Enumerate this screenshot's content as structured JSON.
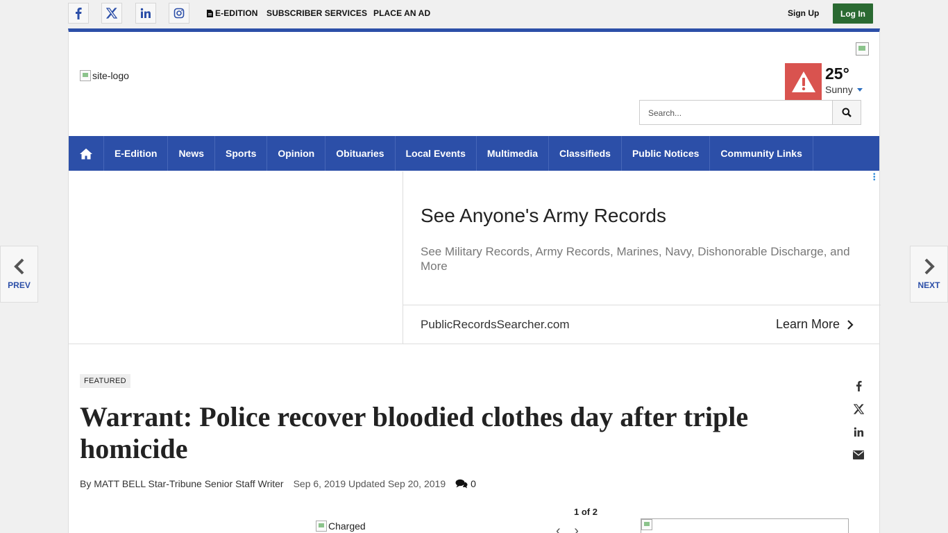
{
  "topbar": {
    "social": [
      {
        "name": "facebook-icon"
      },
      {
        "name": "x-twitter-icon"
      },
      {
        "name": "linkedin-icon"
      },
      {
        "name": "instagram-icon"
      }
    ],
    "eedition_label": "E-EDITION",
    "subscriber_label": "SUBSCRIBER SERVICES",
    "place_ad_label": "PLACE AN AD",
    "signup_label": "Sign Up",
    "login_label": "Log In"
  },
  "header": {
    "logo_alt": "site-logo",
    "weather": {
      "temp": "25°",
      "condition": "Sunny",
      "alert_icon": "warning-icon"
    },
    "search": {
      "placeholder": "Search..."
    }
  },
  "nav": {
    "items": [
      "E-Edition",
      "News",
      "Sports",
      "Opinion",
      "Obituaries",
      "Local Events",
      "Multimedia",
      "Classifieds",
      "Public Notices",
      "Community Links"
    ]
  },
  "ad": {
    "title": "See Anyone's Army Records",
    "description": "See Military Records, Army Records, Marines, Navy, Dishonorable Discharge, and More",
    "domain": "PublicRecordsSearcher.com",
    "cta": "Learn More"
  },
  "article": {
    "badge": "FEATURED",
    "headline": "Warrant: Police recover bloodied clothes day after triple homicide",
    "byline": "By MATT BELL Star-Tribune Senior Staff Writer",
    "dates": "Sep 6, 2019 Updated Sep 20, 2019",
    "comment_count": "0",
    "photo_alt": "Charged",
    "photo_counter": "1 of 2"
  },
  "pager": {
    "prev": "PREV",
    "next": "NEXT"
  },
  "colors": {
    "brand_blue": "#2c4fa8",
    "login_green": "#2a6a32",
    "alert_red": "#d9534f"
  }
}
